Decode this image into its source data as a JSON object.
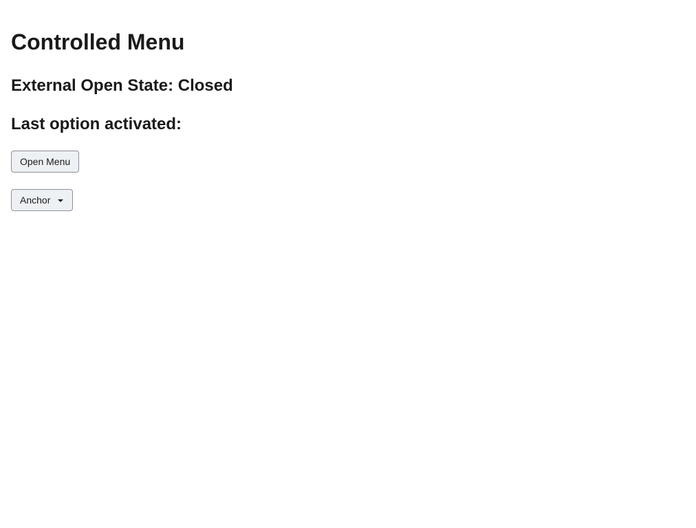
{
  "page": {
    "title": "Controlled Menu",
    "external_open_state_label": "External Open State: Closed",
    "last_option_label": "Last option activated:"
  },
  "controls": {
    "open_menu_label": "Open Menu",
    "anchor_label": "Anchor",
    "anchor_icon": "caret-down-icon"
  },
  "colors": {
    "button_bg": "#eef1f4",
    "button_border": "#8a8f98",
    "text": "#1a1a1a"
  }
}
